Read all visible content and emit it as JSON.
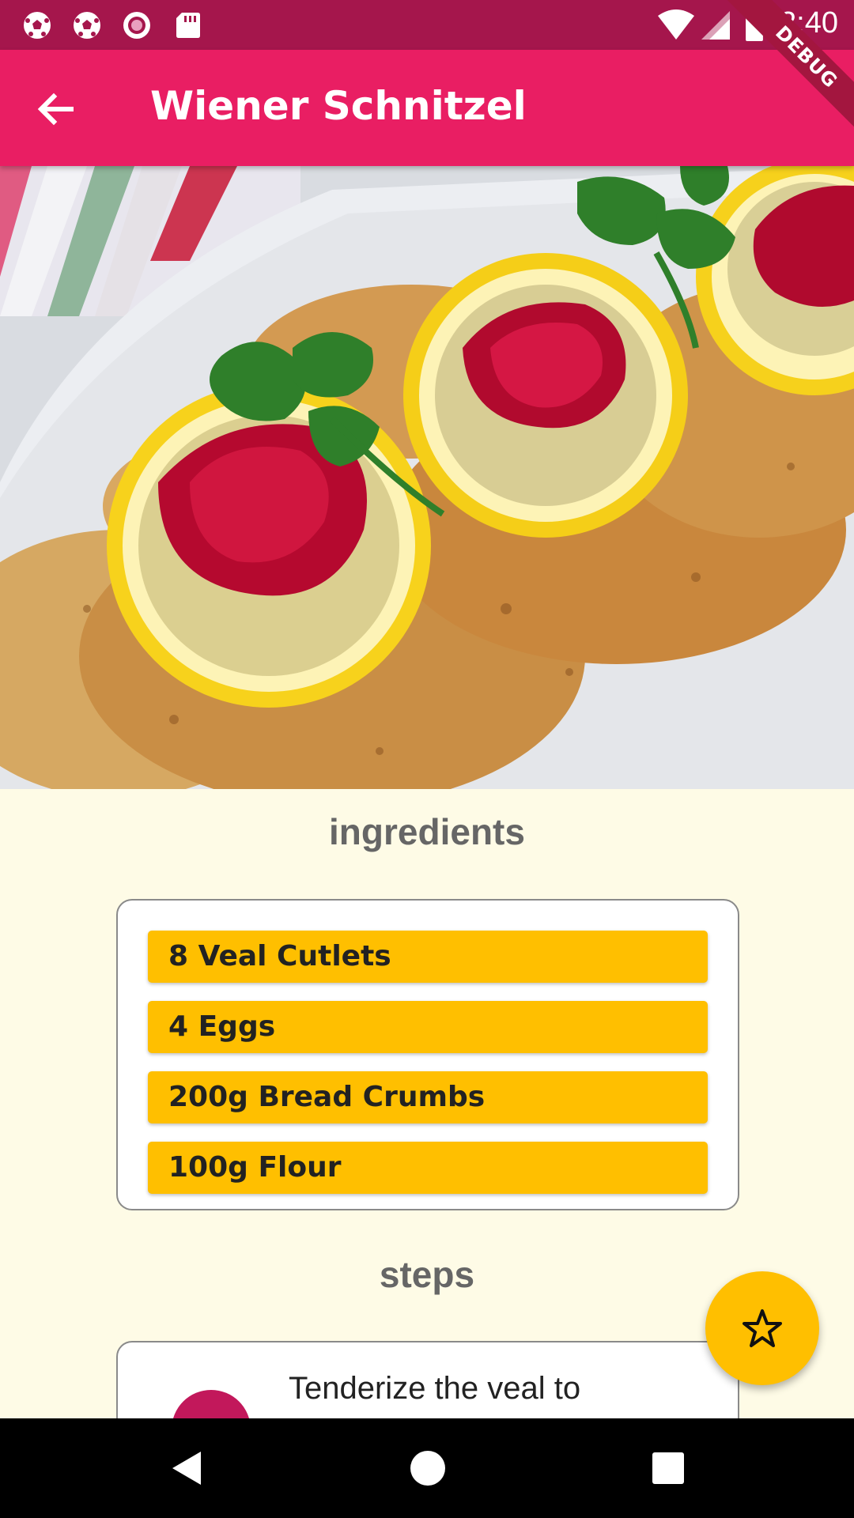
{
  "status_bar": {
    "time": "2:40",
    "left_icons": [
      "soccer-ball-icon",
      "soccer-ball-icon",
      "record-icon",
      "sd-card-icon"
    ],
    "right_icons": [
      "wifi-icon",
      "cell-signal-icon",
      "battery-icon"
    ]
  },
  "debug_banner": "DEBUG",
  "app_bar": {
    "title": "Wiener Schnitzel",
    "back_icon": "arrow-back-icon",
    "color": "#e91e63"
  },
  "ingredients": {
    "title": "ingredients",
    "items": [
      "8 Veal Cutlets",
      "4 Eggs",
      "200g Bread Crumbs",
      "100g Flour"
    ]
  },
  "steps": {
    "title": "steps",
    "items": [
      "Tenderize the veal to"
    ]
  },
  "fab": {
    "icon": "star-outline-icon",
    "color": "#ffbf00"
  },
  "nav_bar": {
    "icons": [
      "back-triangle-icon",
      "home-circle-icon",
      "recents-square-icon"
    ]
  },
  "colors": {
    "accent": "#ffbf00",
    "primary": "#e91e63",
    "status": "#a5164c",
    "background": "#fefbe6"
  }
}
